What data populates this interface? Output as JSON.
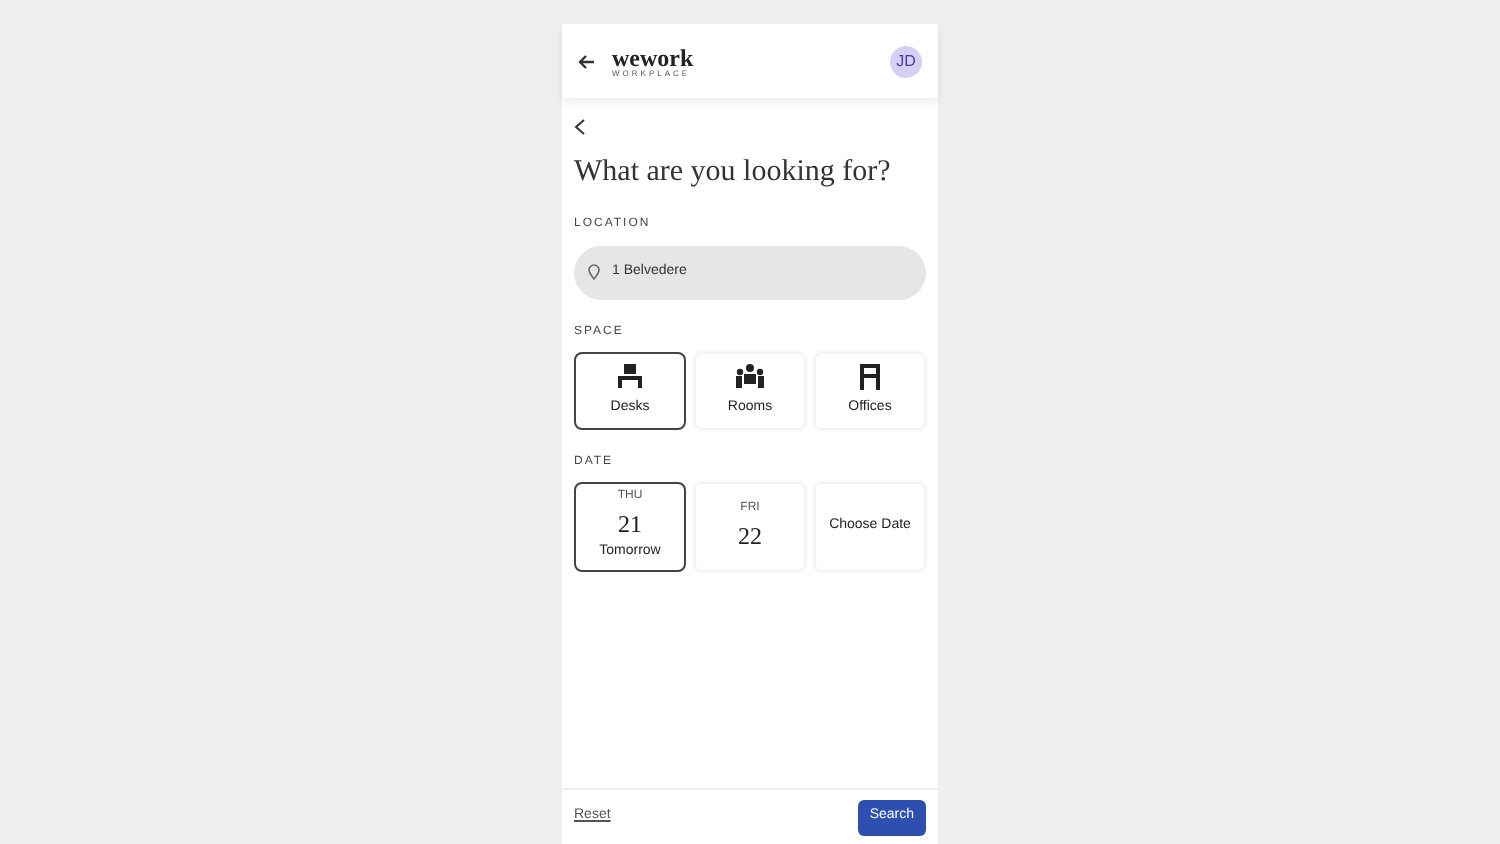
{
  "header": {
    "logo": "wework",
    "logo_sub": "WORKPLACE",
    "avatar": "JD"
  },
  "title": "What are you looking for?",
  "location": {
    "label": "LOCATION",
    "value": "1 Belvedere"
  },
  "space": {
    "label": "SPACE",
    "options": [
      {
        "kind": "desk",
        "label": "Desks",
        "selected": true
      },
      {
        "kind": "room",
        "label": "Rooms",
        "selected": false
      },
      {
        "kind": "office",
        "label": "Offices",
        "selected": false
      }
    ]
  },
  "date": {
    "label": "DATE",
    "options": [
      {
        "kind": "day",
        "weekday": "THU",
        "day": "21",
        "note": "Tomorrow",
        "selected": true
      },
      {
        "kind": "day",
        "weekday": "FRI",
        "day": "22",
        "selected": false
      },
      {
        "kind": "choose",
        "label": "Choose Date",
        "selected": false
      }
    ]
  },
  "footer": {
    "reset": "Reset",
    "search": "Search"
  }
}
